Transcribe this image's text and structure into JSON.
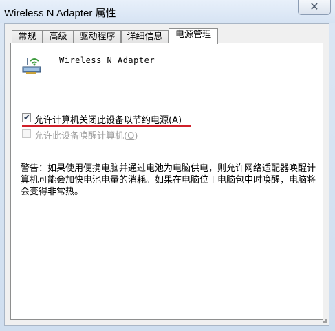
{
  "window": {
    "title": "Wireless N Adapter 属性",
    "close_symbol": "✕"
  },
  "tabs": [
    {
      "label": "常规"
    },
    {
      "label": "高级"
    },
    {
      "label": "驱动程序"
    },
    {
      "label": "详细信息"
    },
    {
      "label": "电源管理"
    }
  ],
  "active_tab": "电源管理",
  "device": {
    "name": "Wireless N Adapter",
    "icon": "network-adapter-icon"
  },
  "options": {
    "allow_off": {
      "label": "允许计算机关闭此设备以节约电源",
      "access_key": "A",
      "checked": true
    },
    "allow_wake": {
      "label": "允许此设备唤醒计算机",
      "access_key": "O",
      "checked": false,
      "disabled": true
    }
  },
  "warning_text": "警告：如果使用便携电脑并通过电池为电脑供电，则允许网络适配器唤醒计算机可能会加快电池电量的消耗。如果在电脑位于电脑包中时唤醒，电脑将会变得非常热。",
  "colors": {
    "highlight_line": "#d0202a",
    "window_frame": "#dce7f4"
  }
}
